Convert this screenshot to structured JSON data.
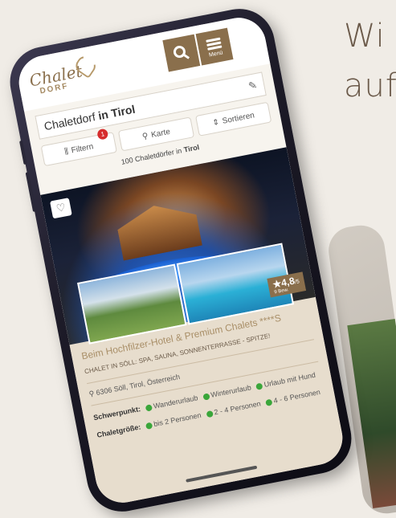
{
  "backdrop": {
    "text_line1": "Wi",
    "text_line2": "auf"
  },
  "header": {
    "logo_text": "Chalet",
    "logo_sub": "DORF",
    "search_icon": "search-icon",
    "menu_label": "Menü"
  },
  "search": {
    "prefix": "Chaletdorf",
    "location": "in Tirol"
  },
  "filters": {
    "filter_label": "Filtern",
    "filter_count": "1",
    "map_label": "Karte",
    "sort_label": "Sortieren"
  },
  "results": {
    "count_text": "100 Chaletdörfer in",
    "count_location": "Tirol"
  },
  "listing": {
    "rating": "4,8",
    "rating_scale": "/5",
    "rating_label": "9 Bew.",
    "title": "Beim Hochfilzer-Hotel & Premium Chalets ****S",
    "tagline": "CHALET IN SÖLL: SPA, SAUNA, SONNENTERRASSE - SPITZE!",
    "location": "6306 Söll, Tirol, Österreich",
    "focus_label": "Schwerpunkt:",
    "focus_items": [
      "Wanderurlaub",
      "Winterurlaub",
      "Urlaub mit Hund"
    ],
    "size_label": "Chaletgröße:",
    "size_items": [
      "bis 2 Personen",
      "2 - 4 Personen",
      "4 - 6 Personen"
    ]
  }
}
